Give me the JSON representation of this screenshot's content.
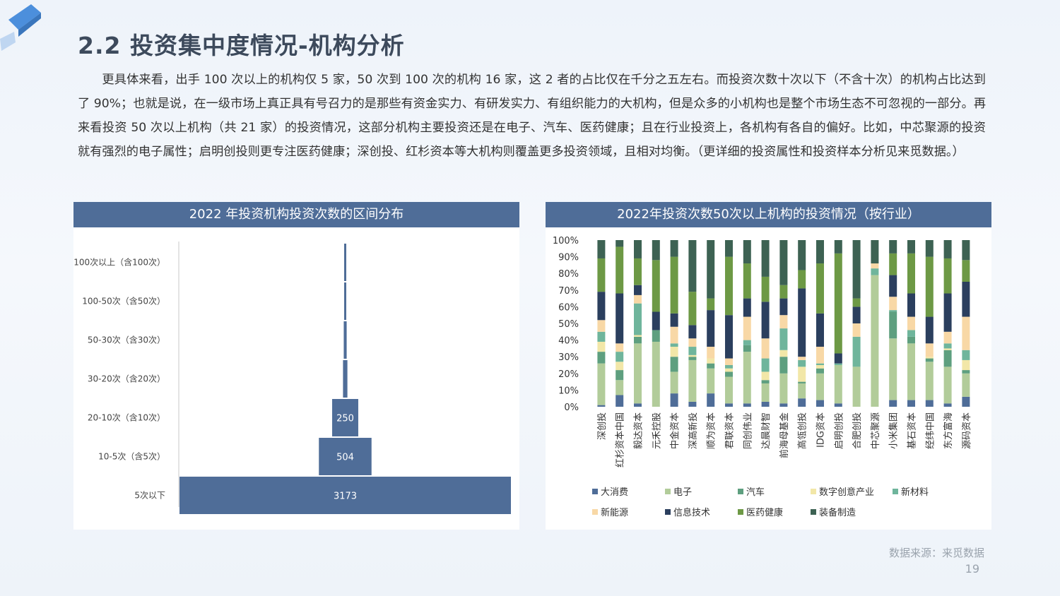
{
  "page": {
    "title": "2.2 投资集中度情况-机构分析",
    "paragraph": "更具体来看，出手 100 次以上的机构仅 5 家，50 次到 100 次的机构 16 家，这 2 者的占比仅在千分之五左右。而投资次数十次以下（不含十次）的机构占比达到了 90%；也就是说，在一级市场上真正具有号召力的是那些有资金实力、有研发实力、有组织能力的大机构，但是众多的小机构也是整个市场生态不可忽视的一部分。再来看投资 50 次以上机构（共 21 家）的投资情况，这部分机构主要投资还是在电子、汽车、医药健康；且在行业投资上，各机构有各自的偏好。比如，中芯聚源的投资就有强烈的电子属性；启明创投则更专注医药健康；深创投、红杉资本等大机构则覆盖更多投资领域，且相对均衡。（更详细的投资属性和投资样本分析见来觅数据。）",
    "source": "数据来源：来觅数据",
    "page_number": "19"
  },
  "chart_data": [
    {
      "type": "bar",
      "title": "2022 年投资机构投资次数的区间分布",
      "orientation": "horizontal-funnel",
      "bar_color": "#4f6d98",
      "categories": [
        "100次以上（含100次）",
        "100-50次（含50次）",
        "50-30次（含30次）",
        "30-20次（含20次）",
        "20-10次（含10次）",
        "10-5次（含5次）",
        "5次以下"
      ],
      "values": [
        5,
        16,
        28,
        42,
        250,
        504,
        3173
      ],
      "data_labels": [
        "",
        "",
        "",
        "",
        "250",
        "504",
        "3173"
      ]
    },
    {
      "type": "bar",
      "stacked": "percent",
      "title": "2022年投资次数50次以上机构的投资情况（按行业）",
      "categories": [
        "深创投",
        "红杉资本中国",
        "毅达资本",
        "元禾控股",
        "中金资本",
        "深高新投",
        "顺为资本",
        "君联资本",
        "同创伟业",
        "达晨财智",
        "前海母基金",
        "高瓴创投",
        "IDG资本",
        "启明创投",
        "合肥创投",
        "中芯聚源",
        "小米集团",
        "基石资本",
        "经纬中国",
        "东方富海",
        "源码资本"
      ],
      "y_ticks": [
        "0%",
        "10%",
        "20%",
        "30%",
        "40%",
        "50%",
        "60%",
        "70%",
        "80%",
        "90%",
        "100%"
      ],
      "ylim": [
        0,
        100
      ],
      "series": [
        {
          "name": "大消费",
          "color": "#4f6d98",
          "values": [
            1,
            7,
            2,
            0,
            8,
            3,
            8,
            2,
            2,
            3,
            2,
            5,
            4,
            2,
            0,
            0,
            4,
            4,
            4,
            2,
            6
          ]
        },
        {
          "name": "电子",
          "color": "#b2cc9a",
          "values": [
            25,
            9,
            36,
            39,
            13,
            25,
            15,
            16,
            31,
            11,
            18,
            9,
            16,
            23,
            24,
            79,
            37,
            34,
            23,
            22,
            14
          ]
        },
        {
          "name": "汽车",
          "color": "#5e9f7f",
          "values": [
            7,
            6,
            4,
            7,
            9,
            2,
            3,
            3,
            4,
            2,
            10,
            1,
            3,
            0,
            0,
            0,
            16,
            4,
            2,
            10,
            2
          ]
        },
        {
          "name": "数字创意产业",
          "color": "#f2e7a8",
          "values": [
            6,
            5,
            1,
            0,
            6,
            1,
            3,
            2,
            0,
            5,
            4,
            9,
            2,
            0,
            0,
            0,
            0,
            0,
            1,
            1,
            6
          ]
        },
        {
          "name": "新材料",
          "color": "#6fb59c",
          "values": [
            6,
            6,
            19,
            0,
            2,
            5,
            0,
            2,
            3,
            8,
            13,
            4,
            1,
            1,
            18,
            4,
            1,
            4,
            0,
            3,
            6
          ]
        },
        {
          "name": "新能源",
          "color": "#f8d8a6",
          "values": [
            7,
            5,
            5,
            0,
            10,
            5,
            7,
            4,
            14,
            12,
            8,
            2,
            10,
            0,
            8,
            3,
            8,
            8,
            8,
            7,
            20
          ]
        },
        {
          "name": "信息技术",
          "color": "#2b3f5e",
          "values": [
            17,
            30,
            6,
            11,
            8,
            8,
            22,
            26,
            11,
            22,
            10,
            41,
            20,
            6,
            10,
            0,
            13,
            14,
            16,
            23,
            21
          ]
        },
        {
          "name": "医药健康",
          "color": "#6d9945",
          "values": [
            20,
            28,
            16,
            31,
            34,
            20,
            7,
            35,
            21,
            15,
            8,
            11,
            30,
            60,
            5,
            0,
            13,
            24,
            36,
            21,
            13
          ]
        },
        {
          "name": "装备制造",
          "color": "#3d6253",
          "values": [
            11,
            4,
            11,
            12,
            10,
            31,
            35,
            10,
            14,
            22,
            27,
            18,
            14,
            8,
            35,
            14,
            8,
            8,
            10,
            11,
            12
          ]
        }
      ]
    }
  ]
}
